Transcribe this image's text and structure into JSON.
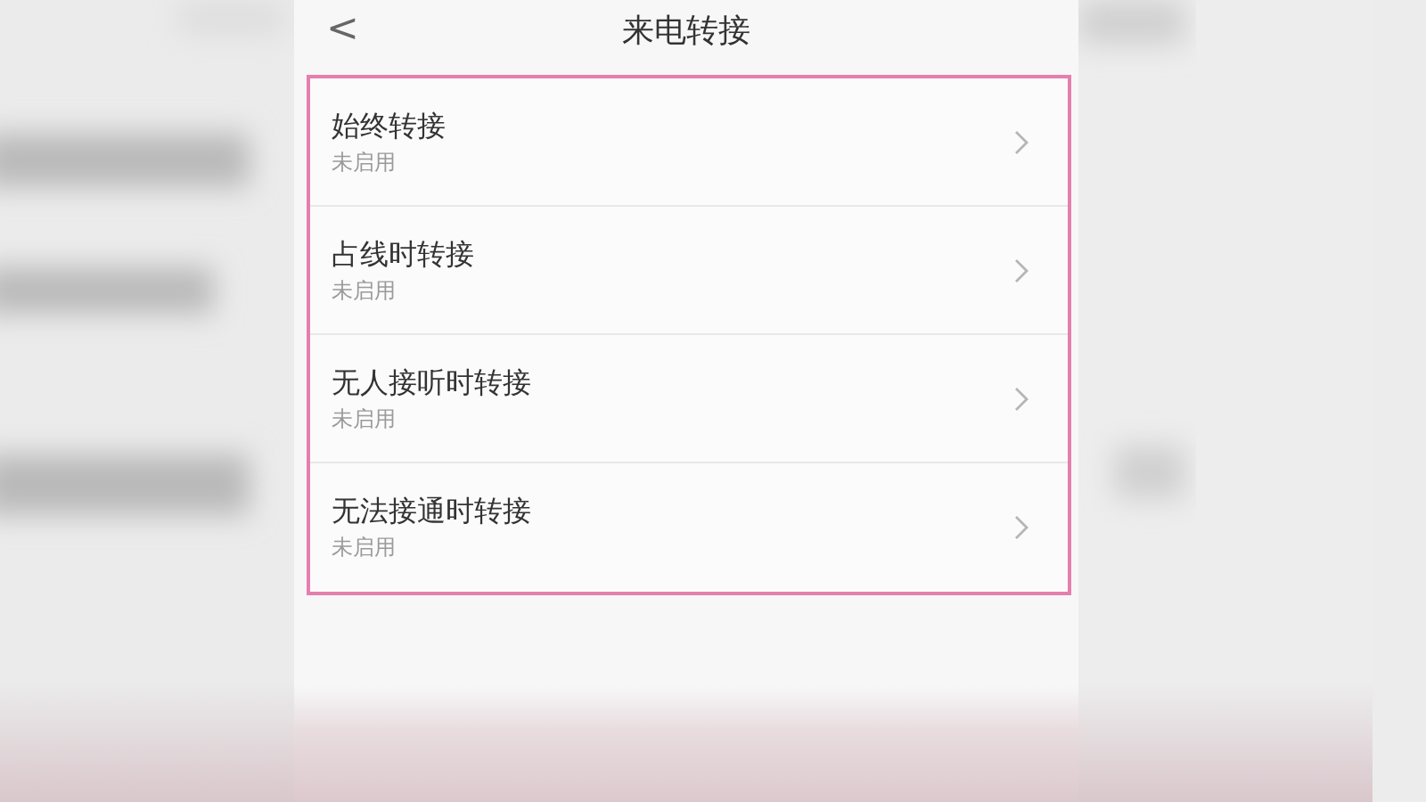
{
  "header": {
    "back": "<",
    "title": "来电转接"
  },
  "items": [
    {
      "title": "始终转接",
      "subtitle": "未启用"
    },
    {
      "title": "占线时转接",
      "subtitle": "未启用"
    },
    {
      "title": "无人接听时转接",
      "subtitle": "未启用"
    },
    {
      "title": "无法接通时转接",
      "subtitle": "未启用"
    }
  ]
}
